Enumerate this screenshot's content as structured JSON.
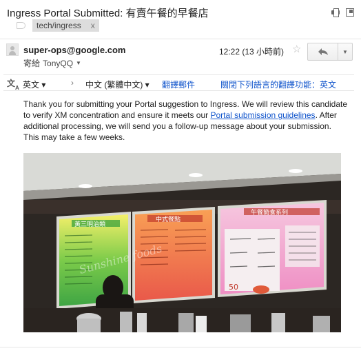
{
  "subject": "Ingress Portal Submitted: 有賣午餐的早餐店",
  "label": {
    "name": "tech/ingress",
    "remove": "x"
  },
  "message": {
    "sender": "super-ops@google.com",
    "recipient_prefix": "寄給",
    "recipient": "TonyQQ",
    "time": "12:22 (13 小時前)",
    "star": "☆"
  },
  "translate": {
    "from_lang": "英文",
    "to_lang": "中文 (繁體中文)",
    "translate_label": "翻譯郵件",
    "turn_off_label": "關閉下列語言的翻譯功能：英文"
  },
  "body": {
    "text_before_link": "Thank you for submitting your Portal suggestion to Ingress. We will review this candidate to verify XM concentration and ensure it meets our ",
    "link_text": "Portal submission guidelines",
    "text_after_link": ". After additional processing, we will send you a follow-up message about your submission. This may take a few weeks."
  },
  "photo": {
    "menu_boards": [
      {
        "title": "黃三明治類",
        "color": "#5fbf3a"
      },
      {
        "title": "中式餐點",
        "color": "#ef6a4c"
      },
      {
        "title": "午餐簡食系列",
        "color": "#f08cc8"
      }
    ],
    "watermark": "Sunshine foods",
    "price_tag": "50"
  },
  "colors": {
    "link": "#1155cc",
    "accent_red": "#c0392b"
  }
}
